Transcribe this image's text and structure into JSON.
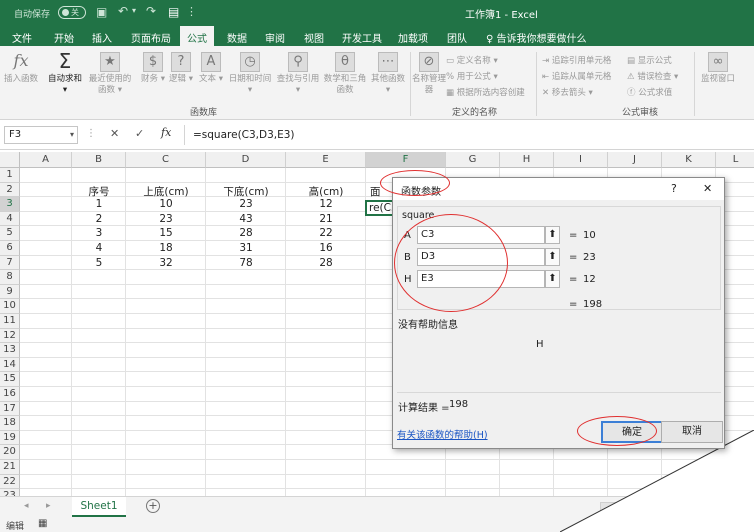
{
  "titlebar": {
    "autosave_label": "自动保存",
    "autosave_state": "关",
    "doc_title": "工作簿1  -  Excel"
  },
  "tabs": [
    "文件",
    "开始",
    "插入",
    "页面布局",
    "公式",
    "数据",
    "审阅",
    "视图",
    "开发工具",
    "加载项",
    "团队"
  ],
  "active_tab": "公式",
  "tell_me": "告诉我你想要做什么",
  "ribbon": {
    "insert_function": "插入函数",
    "autosum": "自动求和",
    "recent": "最近使用的函数",
    "financial": "财务",
    "logical": "逻辑",
    "text": "文本",
    "datetime": "日期和时间",
    "lookup": "查找与引用",
    "math": "数学和三角函数",
    "other": "其他函数",
    "group_library": "函数库",
    "name_manager": "名称管理器",
    "define_name": "定义名称",
    "use_in_formula": "用于公式",
    "create_from_selection": "根据所选内容创建",
    "group_names": "定义的名称",
    "trace_precedents": "追踪引用单元格",
    "trace_dependents": "追踪从属单元格",
    "remove_arrows": "移去箭头",
    "show_formulas": "显示公式",
    "error_checking": "错误检查",
    "evaluate_formula": "公式求值",
    "group_audit": "公式审核",
    "watch_window": "监视窗口"
  },
  "formula_bar": {
    "name_box": "F3",
    "fx": "fx",
    "formula": "=square(C3,D3,E3)"
  },
  "columns": [
    "A",
    "B",
    "C",
    "D",
    "E",
    "F",
    "G",
    "H",
    "I",
    "J",
    "K",
    "L"
  ],
  "rows": [
    "1",
    "2",
    "3",
    "4",
    "5",
    "6",
    "7",
    "8",
    "9",
    "10",
    "11",
    "12",
    "13",
    "14",
    "15",
    "16",
    "17",
    "18",
    "19",
    "20",
    "21",
    "22",
    "23"
  ],
  "table": {
    "headers": [
      "序号",
      "上底(cm)",
      "下底(cm)",
      "高(cm)",
      "面"
    ],
    "data": [
      [
        "1",
        "10",
        "23",
        "12"
      ],
      [
        "2",
        "23",
        "43",
        "21"
      ],
      [
        "3",
        "15",
        "28",
        "22"
      ],
      [
        "4",
        "18",
        "31",
        "16"
      ],
      [
        "5",
        "32",
        "78",
        "28"
      ]
    ],
    "f3_partial": "re(C3"
  },
  "dialog": {
    "title": "函数参数",
    "help_glyph": "?",
    "close_glyph": "✕",
    "function_name": "square",
    "args": [
      {
        "label": "A",
        "value": "C3",
        "result": "10"
      },
      {
        "label": "B",
        "value": "D3",
        "result": "23"
      },
      {
        "label": "H",
        "value": "E3",
        "result": "12"
      }
    ],
    "eq": "=",
    "total_result": "198",
    "no_help": "没有帮助信息",
    "param_desc": "H",
    "calc_label": "计算结果 =",
    "calc_value": "198",
    "help_link": "有关该函数的帮助(H)",
    "ok": "确定",
    "cancel": "取消"
  },
  "sheet_tab": "Sheet1",
  "status": "编辑",
  "colors": {
    "excel_green": "#217346",
    "annotation_red": "#e03030"
  }
}
